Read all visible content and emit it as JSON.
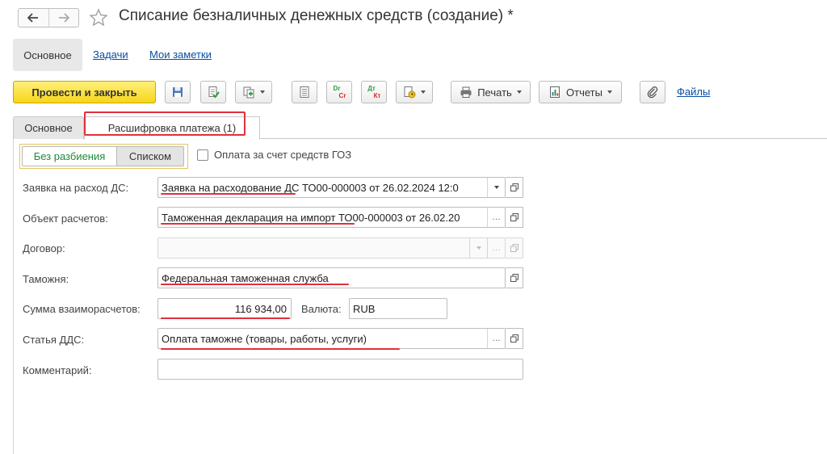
{
  "header": {
    "title": "Списание безналичных денежных средств (создание) *"
  },
  "sections": {
    "active": "Основное",
    "links": [
      "Задачи",
      "Мои заметки"
    ]
  },
  "toolbar": {
    "post_close_label": "Провести и закрыть",
    "print_label": "Печать",
    "reports_label": "Отчеты",
    "files_label": "Файлы",
    "dt_cr_top": "Dr",
    "dt_cr_bottom": "Cr",
    "dt_kt_top": "Дт",
    "dt_kt_bottom": "Кт"
  },
  "tabs": {
    "main": "Основное",
    "payment_breakdown": "Расшифровка платежа (1)"
  },
  "breakdown": {
    "mode_no_split": "Без разбиения",
    "mode_list": "Списком",
    "goz_checkbox_label": "Оплата за счет средств ГОЗ",
    "goz_checked": false
  },
  "form": {
    "request_label": "Заявка на расход ДС:",
    "request_value": "Заявка на расходование ДС ТО00-000003 от 26.02.2024 12:0",
    "object_label": "Объект расчетов:",
    "object_value": "Таможенная декларация на импорт ТО00-000003 от 26.02.20",
    "contract_label": "Договор:",
    "contract_value": "",
    "customs_label": "Таможня:",
    "customs_value": "Федеральная таможенная служба",
    "amount_label": "Сумма взаиморасчетов:",
    "amount_value": "116 934,00",
    "currency_label": "Валюта:",
    "currency_value": "RUB",
    "cash_flow_label": "Статья ДДС:",
    "cash_flow_value": "Оплата таможне (товары, работы, услуги)",
    "comment_label": "Комментарий:",
    "comment_value": ""
  },
  "colors": {
    "accent_yellow": "#f7d51a",
    "link_blue": "#0a4da2",
    "highlight_red": "#e0303c",
    "active_mode_green": "#1e8a3a"
  }
}
